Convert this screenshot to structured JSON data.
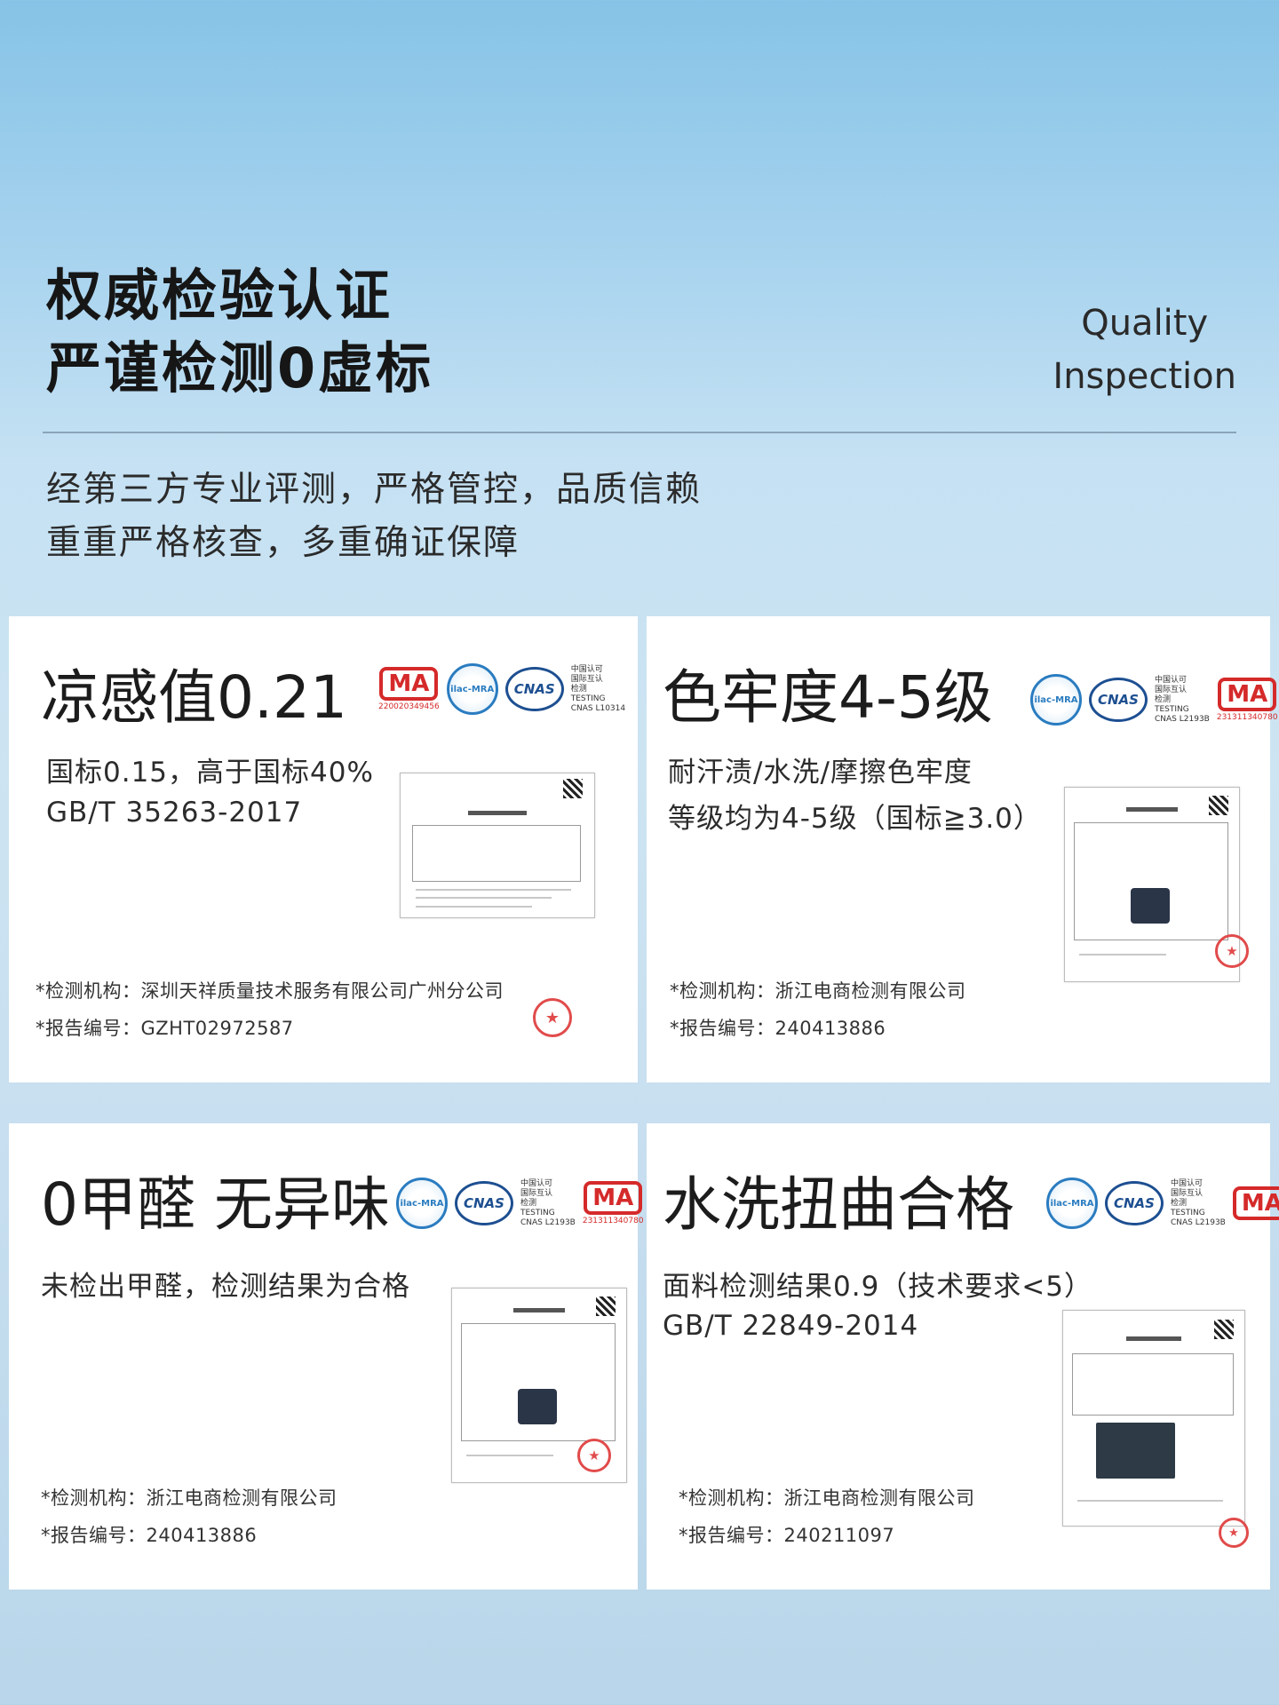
{
  "hero": {
    "title_line1": "权威检验认证",
    "title_line2": "严谨检测0虚标",
    "en_line1": "Quality",
    "en_line2": "Inspection",
    "desc_line1": "经第三方专业评测，严格管控，品质信赖",
    "desc_line2": "重重严格核查，多重确证保障"
  },
  "logos": {
    "ma": "MA",
    "ma_num_a": "220020349456",
    "ma_num_b": "231311340780",
    "ilac": "ilac-MRA",
    "cnas": "CNAS",
    "cnas_text_a": "中国认可\n国际互认\n检测\nTESTING\nCNAS L10314",
    "cnas_text_b": "中国认可\n国际互认\n检测\nTESTING\nCNAS L2193B"
  },
  "cards": [
    {
      "title": "凉感值0.21",
      "line1": "国标0.15，高于国标40%",
      "line2": "GB/T 35263-2017",
      "institution": "*检测机构：深圳天祥质量技术服务有限公司广州分公司",
      "report_no": "*报告编号：GZHT02972587"
    },
    {
      "title": "色牢度4-5级",
      "line1": "耐汗渍/水洗/摩擦色牢度",
      "line2": "等级均为4-5级（国标≧3.0）",
      "institution": "*检测机构：浙江电商检测有限公司",
      "report_no": "*报告编号：240413886"
    },
    {
      "title": "0甲醛 无异味",
      "line1": "未检出甲醛，检测结果为合格",
      "institution": "*检测机构：浙江电商检测有限公司",
      "report_no": "*报告编号：240413886"
    },
    {
      "title": "水洗扭曲合格",
      "line1": "面料检测结果0.9（技术要求<5）",
      "line2": "GB/T 22849-2014",
      "institution": "*检测机构：浙江电商检测有限公司",
      "report_no": "*报告编号：240211097"
    }
  ],
  "colors": {
    "ma_red": "#d52a2a",
    "cnas_blue": "#1d4f91",
    "ilac_blue": "#2a7cc0"
  }
}
